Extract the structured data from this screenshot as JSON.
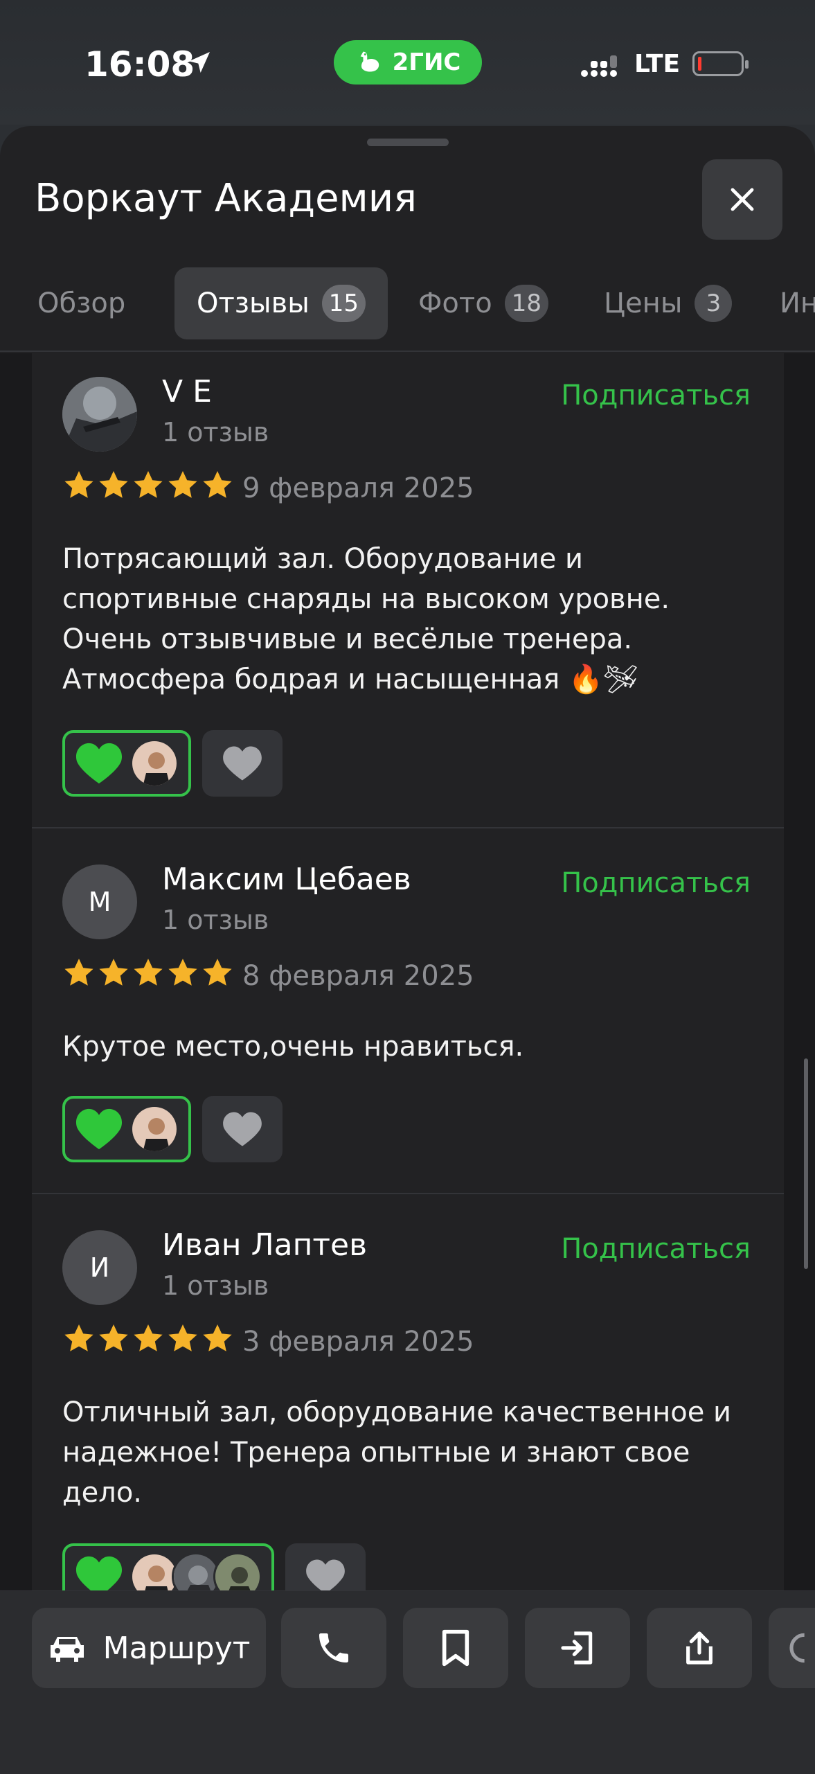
{
  "status_bar": {
    "time": "16:08",
    "app_badge": "2ГИС",
    "network": "LTE",
    "battery_level_percent": 5,
    "battery_color": "#ff3b30"
  },
  "colors": {
    "accent": "#35c24a",
    "star": "#f6b32a",
    "sheet_bg": "#222224"
  },
  "sheet": {
    "title": "Воркаут Академия",
    "close_icon": "close-icon"
  },
  "tabs": [
    {
      "label": "Обзор",
      "badge": "",
      "active": false
    },
    {
      "label": "Отзывы",
      "badge": "15",
      "active": true
    },
    {
      "label": "Фото",
      "badge": "18",
      "active": false
    },
    {
      "label": "Цены",
      "badge": "3",
      "active": false
    },
    {
      "label": "Ин",
      "badge": "",
      "active": false
    }
  ],
  "reviews": [
    {
      "author": "V E",
      "reviews_count": "1 отзыв",
      "subscribe": "Подписаться",
      "rating": 5,
      "date": "9 февраля 2025",
      "text_lines": [
        "Потрясающий зал. Оборудование и",
        "спортивные снаряды на высоком уровне.",
        "Очень отзывчивые и весёлые тренера.",
        "Атмосфера бодрая и насыщенная 🔥🛩"
      ],
      "avatar_letter": ""
    },
    {
      "author": "Максим Цебаев",
      "reviews_count": "1 отзыв",
      "subscribe": "Подписаться",
      "rating": 5,
      "date": "8 февраля 2025",
      "text_lines": [
        "Крутое место,очень нравиться."
      ],
      "avatar_letter": "М"
    },
    {
      "author": "Иван Лаптев",
      "reviews_count": "1 отзыв",
      "subscribe": "Подписаться",
      "rating": 5,
      "date": "3 февраля 2025",
      "text_lines": [
        "Отличный зал, оборудование качественное и",
        "надежное! Тренера опытные и знают свое",
        "дело."
      ],
      "avatar_letter": "И"
    }
  ],
  "bottom_bar": {
    "route_label": "Маршрут",
    "icons": [
      "car-icon",
      "phone-icon",
      "bookmark-icon",
      "entrance-icon",
      "share-icon",
      "more-icon"
    ]
  }
}
